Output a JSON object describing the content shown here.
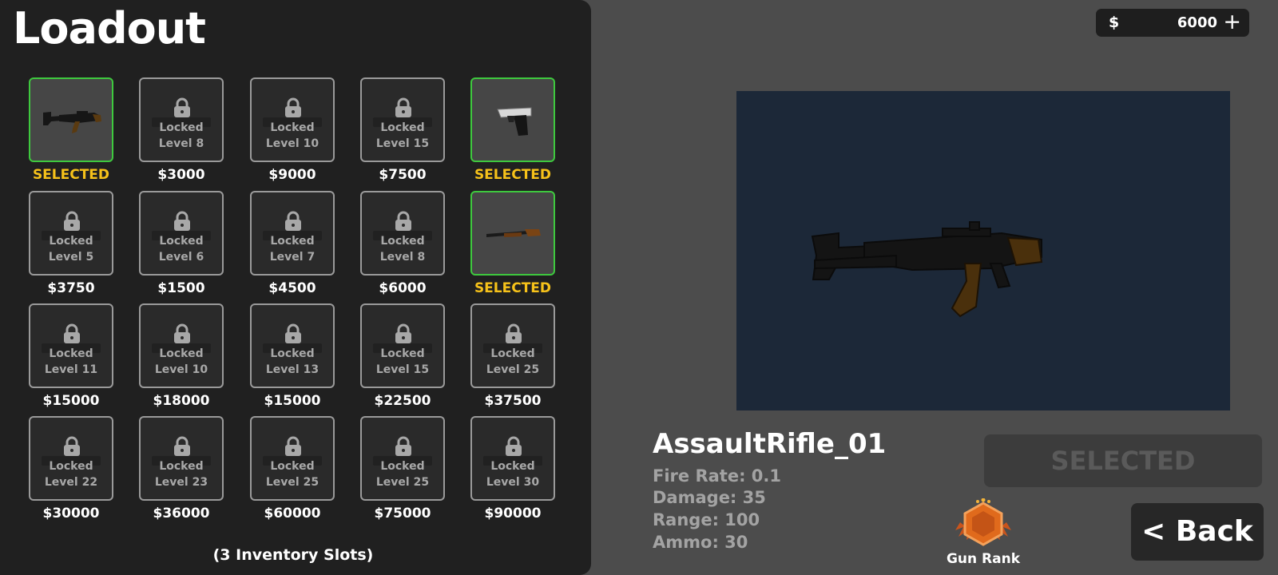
{
  "title": "Loadout",
  "currency": {
    "symbol": "$",
    "amount": "6000",
    "add_label": "+"
  },
  "inventory_note": "(3 Inventory Slots)",
  "weapons": [
    {
      "locked": false,
      "selected": true,
      "icon": "assault-rifle-icon",
      "price": "SELECTED"
    },
    {
      "locked": true,
      "line1": "Locked",
      "line2": "Level 8",
      "price": "$3000"
    },
    {
      "locked": true,
      "line1": "Locked",
      "line2": "Level 10",
      "price": "$9000"
    },
    {
      "locked": true,
      "line1": "Locked",
      "line2": "Level 15",
      "price": "$7500"
    },
    {
      "locked": false,
      "selected": true,
      "icon": "pistol-icon",
      "price": "SELECTED"
    },
    {
      "locked": true,
      "line1": "Locked",
      "line2": "Level 5",
      "price": "$3750"
    },
    {
      "locked": true,
      "line1": "Locked",
      "line2": "Level 6",
      "price": "$1500"
    },
    {
      "locked": true,
      "line1": "Locked",
      "line2": "Level 7",
      "price": "$4500"
    },
    {
      "locked": true,
      "line1": "Locked",
      "line2": "Level 8",
      "price": "$6000"
    },
    {
      "locked": false,
      "selected": true,
      "icon": "shotgun-icon",
      "price": "SELECTED"
    },
    {
      "locked": true,
      "line1": "Locked",
      "line2": "Level 11",
      "price": "$15000"
    },
    {
      "locked": true,
      "line1": "Locked",
      "line2": "Level 10",
      "price": "$18000"
    },
    {
      "locked": true,
      "line1": "Locked",
      "line2": "Level 13",
      "price": "$15000"
    },
    {
      "locked": true,
      "line1": "Locked",
      "line2": "Level 15",
      "price": "$22500"
    },
    {
      "locked": true,
      "line1": "Locked",
      "line2": "Level 25",
      "price": "$37500"
    },
    {
      "locked": true,
      "line1": "Locked",
      "line2": "Level 22",
      "price": "$30000"
    },
    {
      "locked": true,
      "line1": "Locked",
      "line2": "Level 23",
      "price": "$36000"
    },
    {
      "locked": true,
      "line1": "Locked",
      "line2": "Level 25",
      "price": "$60000"
    },
    {
      "locked": true,
      "line1": "Locked",
      "line2": "Level 25",
      "price": "$75000"
    },
    {
      "locked": true,
      "line1": "Locked",
      "line2": "Level 30",
      "price": "$90000"
    }
  ],
  "details": {
    "name": "AssaultRifle_01",
    "stats": [
      "Fire Rate: 0.1",
      "Damage: 35",
      "Range: 100",
      "Ammo: 30"
    ],
    "status_button": "SELECTED",
    "back_button": "< Back",
    "rank_label": "Gun Rank",
    "preview_icon": "assault-rifle-icon"
  },
  "colors": {
    "selected_border": "#3ec93e",
    "selected_text": "#f6c21a",
    "preview_bg": "#1c2838",
    "rank_badge": "#e06a1c"
  }
}
